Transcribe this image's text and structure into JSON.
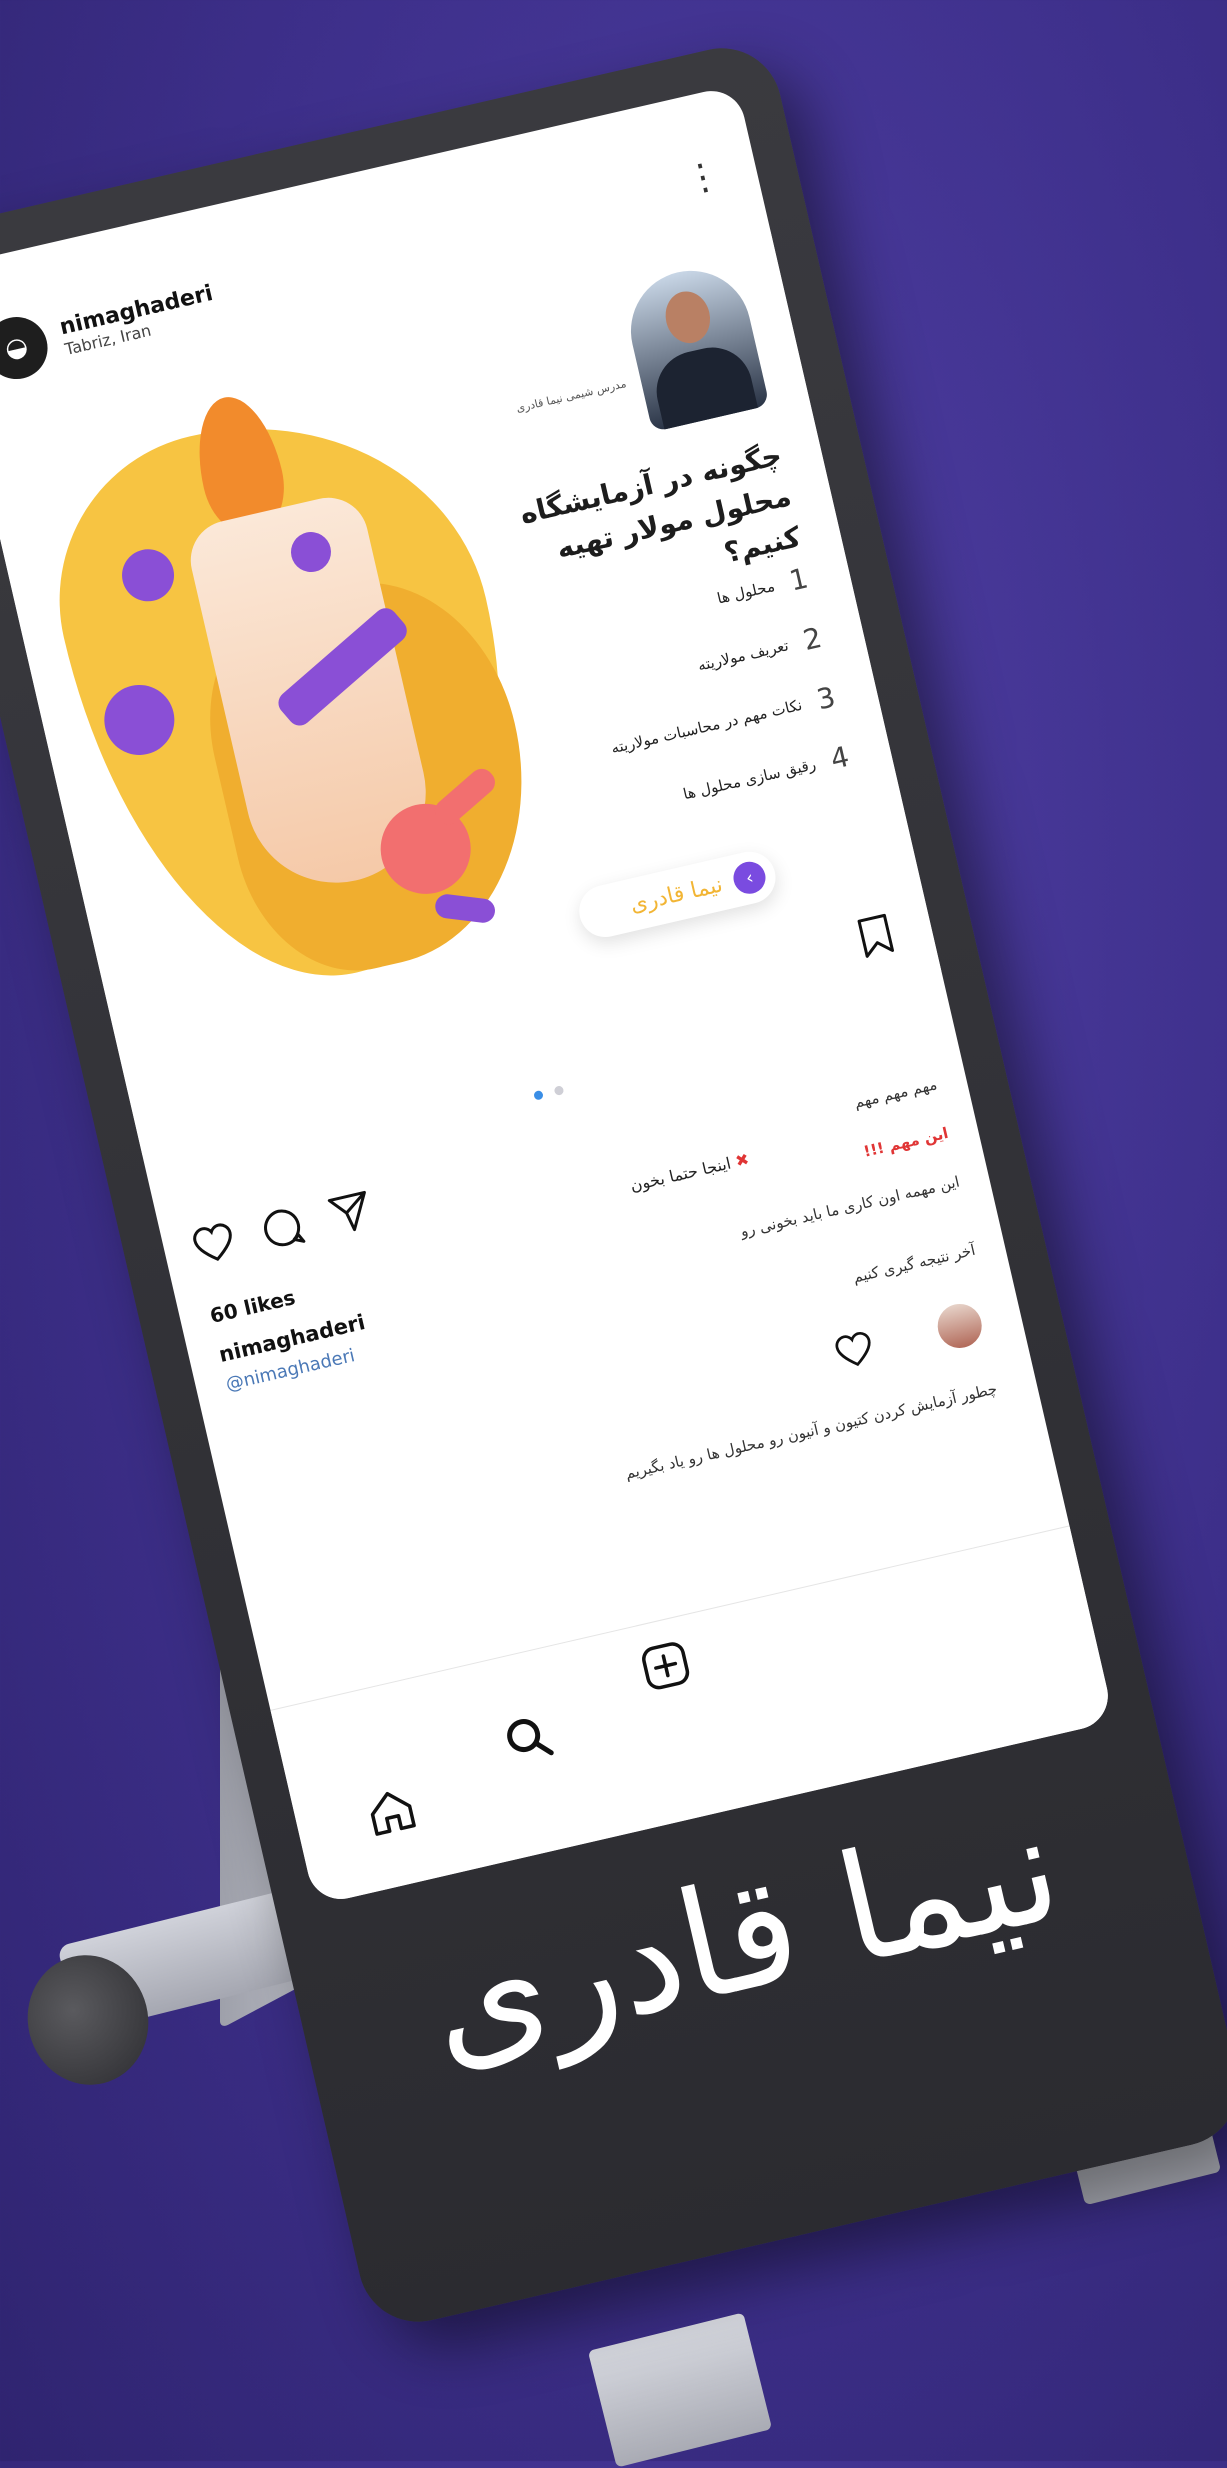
{
  "post": {
    "username": "nimaghaderi",
    "location": "Tabriz, Iran",
    "likes": "60 likes",
    "caption_user": "nimaghaderi",
    "mention": "@nimaghaderi",
    "caption_line_1": "مهم مهم مهم",
    "caption_line_2": "این مهم !!!",
    "caption_line_3": "اینجا حتما بخون",
    "caption_line_4": "این مهمه اون کاری ما باید بخونی رو",
    "caption_line_5": "آخر نتیجه گیری کنیم",
    "comment_line": "چطور آزمایش کردن کتیون و آنیون رو محلول ها رو یاد بگیریم"
  },
  "image": {
    "headline": "چگونه در آزمایشگاه محلول مولار تهیه کنیم؟",
    "author_caption": "مدرس شیمی نیما قادری",
    "list": [
      {
        "num": "1",
        "text": "محلول ها"
      },
      {
        "num": "2",
        "text": "تعریف مولاریته"
      },
      {
        "num": "3",
        "text": "نکات مهم در محاسبات مولاریته"
      },
      {
        "num": "4",
        "text": "رقیق سازی محلول ها"
      }
    ],
    "cta_text": "نیما قادری",
    "cta_arrow": "‹"
  },
  "brand": {
    "logo_text": "نیما قادری"
  },
  "ui": {
    "more_icon": "⋮",
    "avatar_glyph": "◒",
    "dots_active": 0
  },
  "colors": {
    "accent_purple": "#7a4be0",
    "accent_yellow": "#f7c442",
    "background": "#3d2f8a",
    "device": "#2b2b30"
  }
}
